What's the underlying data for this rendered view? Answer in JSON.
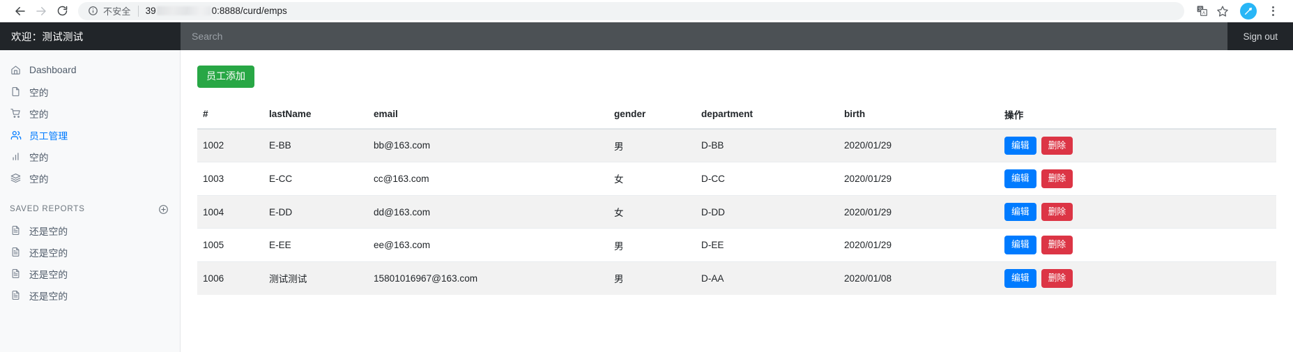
{
  "browser": {
    "back_icon": "arrow-left-icon",
    "forward_icon": "arrow-right-icon",
    "reload_icon": "reload-icon",
    "security_label": "不安全",
    "url_prefix": "39",
    "url_suffix": "0:8888/curd/emps",
    "url_full": "39[redacted]0:8888/curd/emps",
    "translate_icon": "translate-icon",
    "bookmark_icon": "star-icon",
    "profile_icon": "profile-avatar-icon",
    "menu_icon": "three-dot-menu-icon"
  },
  "header": {
    "brand": "欢迎：测试测试",
    "search_placeholder": "Search",
    "search_value": "",
    "sign_out": "Sign out"
  },
  "sidebar": {
    "items": [
      {
        "label": "Dashboard",
        "icon": "home-icon",
        "active": false
      },
      {
        "label": "空的",
        "icon": "file-icon",
        "active": false
      },
      {
        "label": "空的",
        "icon": "shopping-cart-icon",
        "active": false
      },
      {
        "label": "员工管理",
        "icon": "users-icon",
        "active": true
      },
      {
        "label": "空的",
        "icon": "bar-chart-icon",
        "active": false
      },
      {
        "label": "空的",
        "icon": "layers-icon",
        "active": false
      }
    ],
    "section_title": "SAVED REPORTS",
    "add_report_icon": "plus-circle-icon",
    "reports": [
      {
        "label": "还是空的",
        "icon": "file-text-icon"
      },
      {
        "label": "还是空的",
        "icon": "file-text-icon"
      },
      {
        "label": "还是空的",
        "icon": "file-text-icon"
      },
      {
        "label": "还是空的",
        "icon": "file-text-icon"
      }
    ]
  },
  "main": {
    "add_button": "员工添加",
    "columns": [
      "#",
      "lastName",
      "email",
      "gender",
      "department",
      "birth",
      "操作"
    ],
    "rows": [
      {
        "id": "1002",
        "lastName": "E-BB",
        "email": "bb@163.com",
        "gender": "男",
        "department": "D-BB",
        "birth": "2020/01/29",
        "edit": "编辑",
        "delete": "删除"
      },
      {
        "id": "1003",
        "lastName": "E-CC",
        "email": "cc@163.com",
        "gender": "女",
        "department": "D-CC",
        "birth": "2020/01/29",
        "edit": "编辑",
        "delete": "删除"
      },
      {
        "id": "1004",
        "lastName": "E-DD",
        "email": "dd@163.com",
        "gender": "女",
        "department": "D-DD",
        "birth": "2020/01/29",
        "edit": "编辑",
        "delete": "删除"
      },
      {
        "id": "1005",
        "lastName": "E-EE",
        "email": "ee@163.com",
        "gender": "男",
        "department": "D-EE",
        "birth": "2020/01/29",
        "edit": "编辑",
        "delete": "删除"
      },
      {
        "id": "1006",
        "lastName": "测试测试",
        "email": "15801016967@163.com",
        "gender": "男",
        "department": "D-AA",
        "birth": "2020/01/08",
        "edit": "编辑",
        "delete": "删除"
      }
    ]
  },
  "colors": {
    "brand_bg": "#212529",
    "search_bg": "#4c5155",
    "sidebar_bg": "#f8f9fa",
    "accent_blue": "#007bff",
    "success_green": "#28a745",
    "danger_red": "#dc3545",
    "row_stripe": "#f2f2f2"
  }
}
